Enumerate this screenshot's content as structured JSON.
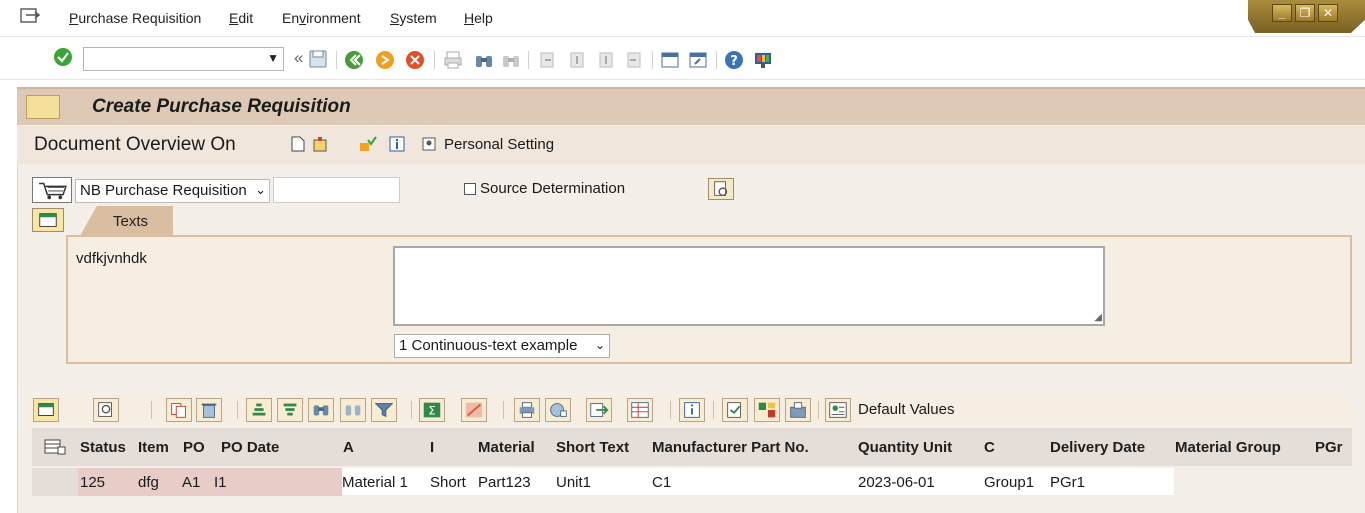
{
  "menubar": {
    "items": [
      {
        "pre": "",
        "u": "P",
        "post": "urchase Requisition"
      },
      {
        "pre": "",
        "u": "E",
        "post": "dit"
      },
      {
        "pre": "En",
        "u": "v",
        "post": "ironment"
      },
      {
        "pre": "",
        "u": "S",
        "post": "ystem"
      },
      {
        "pre": "",
        "u": "H",
        "post": "elp"
      }
    ]
  },
  "window_controls": {
    "minimize": "_",
    "restore": "❐",
    "close": "✕"
  },
  "toolbar": {
    "command_value": "",
    "collapse_glyph": "«"
  },
  "screen": {
    "title": "Create Purchase Requisition",
    "overview_button": "Document Overview On",
    "personal_setting": "Personal Setting"
  },
  "header": {
    "doc_type": "NB Purchase Requisition",
    "doc_number": "",
    "source_determination_label": "Source Determination",
    "source_determination_checked": false
  },
  "texts_tab": {
    "tab_label": "Texts",
    "text_name": "vdfkjvnhdk",
    "text_content": "",
    "format_select": "1 Continuous-text example"
  },
  "grid_toolbar": {
    "default_values": "Default Values"
  },
  "grid": {
    "columns": [
      "Status",
      "Item",
      "PO",
      "PO Date",
      "A",
      "I",
      "Material",
      "Short Text",
      "Manufacturer Part No.",
      "Quantity Unit",
      "C",
      "Delivery Date",
      "Material Group",
      "PGr"
    ],
    "rows": [
      {
        "status": "125",
        "item": "dfg",
        "po": "A1",
        "po_date": "I1",
        "a": "Material 1",
        "i": "Short",
        "material": "Part123",
        "short_text": "Unit1",
        "manufacturer_part": "C1",
        "quantity_unit": "2023-06-01",
        "c": "Group1",
        "delivery_date": "PGr1"
      }
    ]
  },
  "colors": {
    "accent": "#dec9b7",
    "tab": "#d9bea2",
    "ok_green": "#3aa535"
  }
}
